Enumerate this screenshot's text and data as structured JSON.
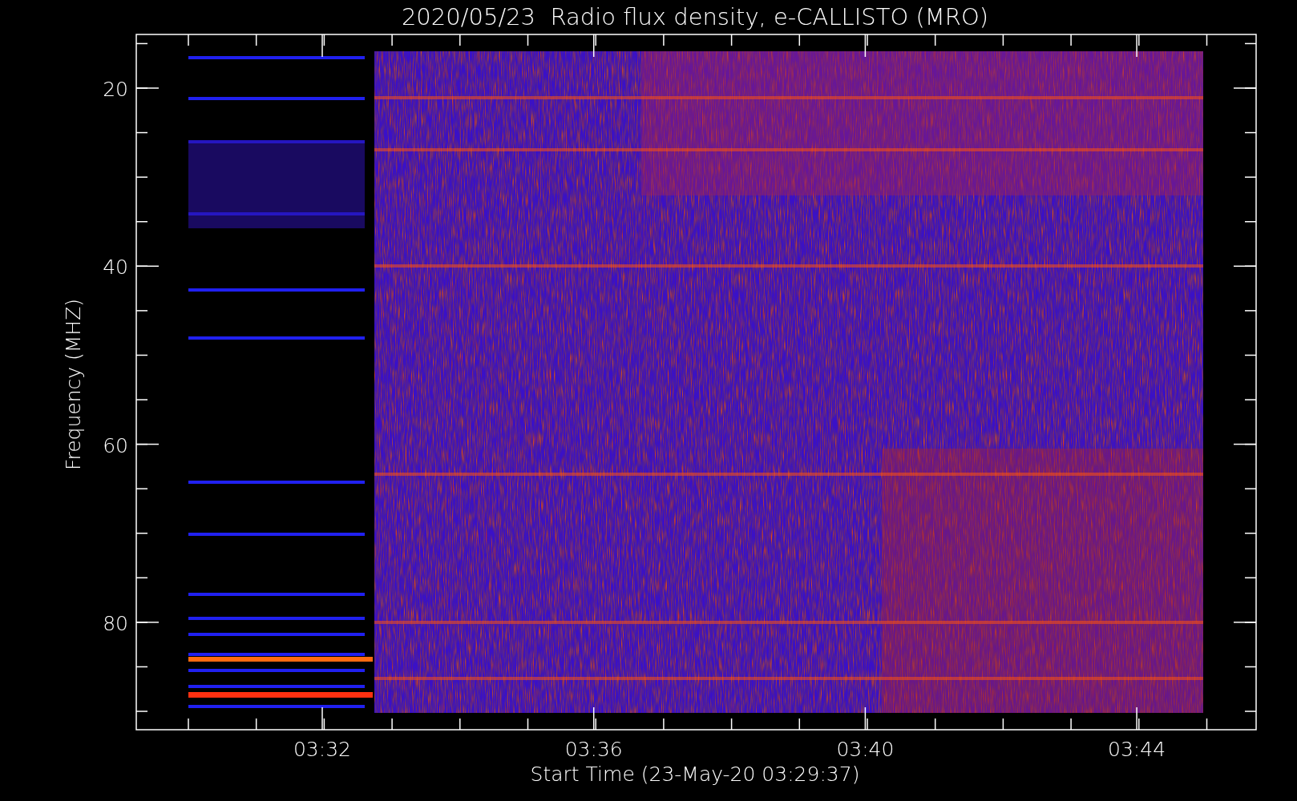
{
  "title": "2020/05/23  Radio flux density, e-CALLISTO (MRO)",
  "y_axis": {
    "label": "Frequency (MHZ)",
    "ticks": [
      "20",
      "40",
      "60",
      "80"
    ]
  },
  "x_axis": {
    "label": "Start Time (23-May-20 03:29:37)",
    "ticks": [
      "03:32",
      "03:36",
      "03:40",
      "03:44"
    ]
  }
}
